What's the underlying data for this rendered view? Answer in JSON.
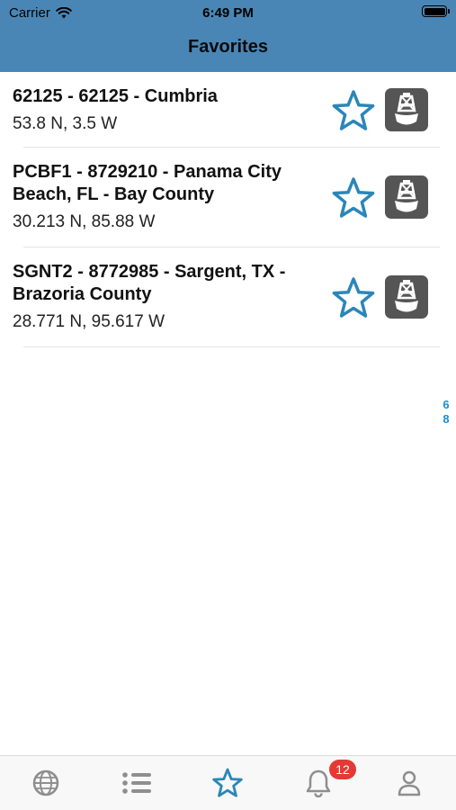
{
  "status_bar": {
    "carrier": "Carrier",
    "time": "6:49 PM"
  },
  "header": {
    "title": "Favorites"
  },
  "favorites": [
    {
      "name": "62125 - 62125 - Cumbria",
      "coords": "53.8 N, 3.5 W"
    },
    {
      "name": "PCBF1 - 8729210 - Panama City Beach, FL - Bay County",
      "coords": "30.213 N, 85.88 W"
    },
    {
      "name": "SGNT2 - 8772985 - Sargent, TX - Brazoria County",
      "coords": "28.771 N, 95.617 W"
    }
  ],
  "index_letters": [
    "6",
    "8"
  ],
  "tabbar": {
    "items": [
      {
        "icon": "globe-icon"
      },
      {
        "icon": "list-icon"
      },
      {
        "icon": "star-icon",
        "active": true
      },
      {
        "icon": "bell-icon",
        "badge": "12"
      },
      {
        "icon": "person-icon"
      }
    ]
  },
  "colors": {
    "header": "#4a86b5",
    "accent": "#2b86b8",
    "badge": "#e53935",
    "index": "#1a8be0",
    "inactive_tab": "#8e8e8e"
  }
}
